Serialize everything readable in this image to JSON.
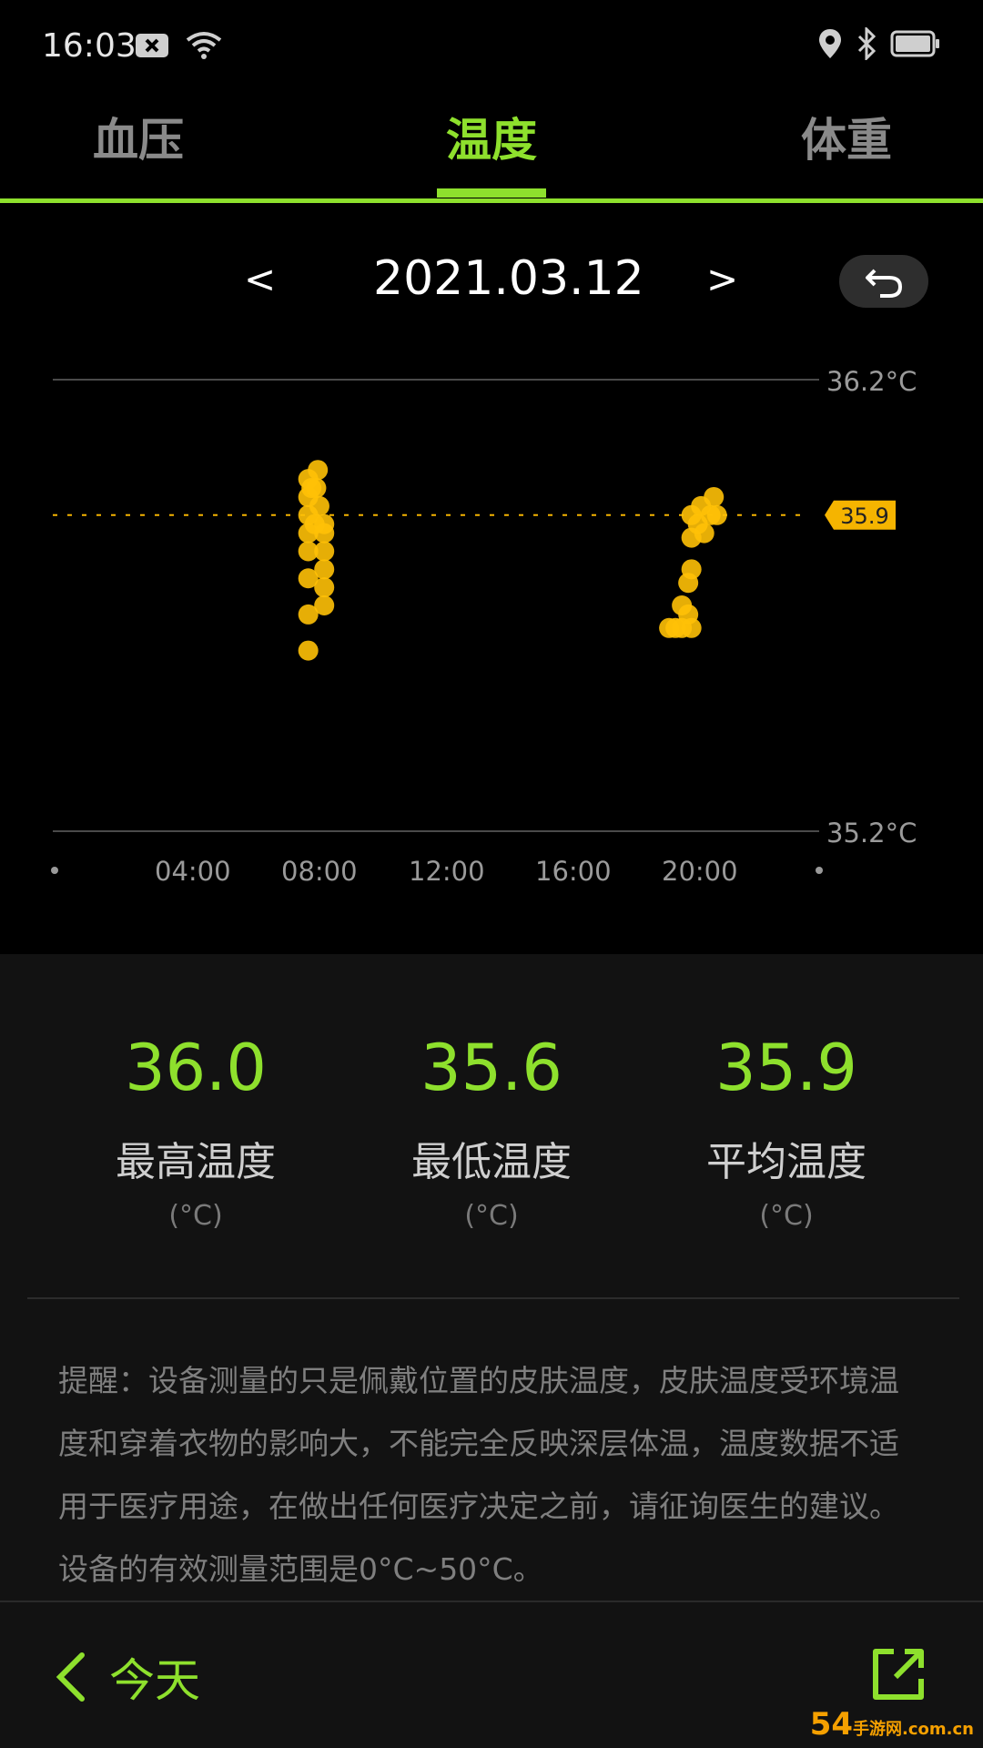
{
  "status_bar": {
    "time": "16:03"
  },
  "tabs": [
    {
      "label": "血压"
    },
    {
      "label": "温度"
    },
    {
      "label": "体重"
    }
  ],
  "date_nav": {
    "prev": "<",
    "date": "2021.03.12",
    "next": ">"
  },
  "chart_data": {
    "type": "scatter",
    "ylim": [
      35.2,
      36.2
    ],
    "y_axis_labels": [
      "36.2°C",
      "35.2°C"
    ],
    "x_ticks": [
      "04:00",
      "08:00",
      "12:00",
      "16:00",
      "20:00"
    ],
    "average_line": 35.9,
    "average_label": "35.9",
    "points": [
      {
        "x": 8.0,
        "y": 35.6
      },
      {
        "x": 8.0,
        "y": 35.68
      },
      {
        "x": 8.0,
        "y": 35.76
      },
      {
        "x": 8.0,
        "y": 35.82
      },
      {
        "x": 8.0,
        "y": 35.86
      },
      {
        "x": 8.0,
        "y": 35.9
      },
      {
        "x": 8.0,
        "y": 35.94
      },
      {
        "x": 8.0,
        "y": 35.98
      },
      {
        "x": 8.1,
        "y": 35.96
      },
      {
        "x": 8.2,
        "y": 35.88
      },
      {
        "x": 8.25,
        "y": 35.96
      },
      {
        "x": 8.3,
        "y": 36.0
      },
      {
        "x": 8.35,
        "y": 35.92
      },
      {
        "x": 8.5,
        "y": 35.78
      },
      {
        "x": 8.5,
        "y": 35.82
      },
      {
        "x": 8.5,
        "y": 35.86
      },
      {
        "x": 8.5,
        "y": 35.88
      },
      {
        "x": 8.5,
        "y": 35.74
      },
      {
        "x": 8.5,
        "y": 35.7
      },
      {
        "x": 19.3,
        "y": 35.65
      },
      {
        "x": 19.5,
        "y": 35.65
      },
      {
        "x": 19.7,
        "y": 35.65
      },
      {
        "x": 19.7,
        "y": 35.7
      },
      {
        "x": 19.9,
        "y": 35.68
      },
      {
        "x": 19.9,
        "y": 35.75
      },
      {
        "x": 20.0,
        "y": 35.65
      },
      {
        "x": 20.0,
        "y": 35.78
      },
      {
        "x": 20.0,
        "y": 35.85
      },
      {
        "x": 20.0,
        "y": 35.9
      },
      {
        "x": 20.2,
        "y": 35.88
      },
      {
        "x": 20.3,
        "y": 35.92
      },
      {
        "x": 20.4,
        "y": 35.86
      },
      {
        "x": 20.6,
        "y": 35.9
      },
      {
        "x": 20.7,
        "y": 35.94
      },
      {
        "x": 20.8,
        "y": 35.9
      }
    ]
  },
  "stats": [
    {
      "value": "36.0",
      "label": "最高温度",
      "unit": "(°C)"
    },
    {
      "value": "35.6",
      "label": "最低温度",
      "unit": "(°C)"
    },
    {
      "value": "35.9",
      "label": "平均温度",
      "unit": "(°C)"
    }
  ],
  "note": "提醒：设备测量的只是佩戴位置的皮肤温度，皮肤温度受环境温度和穿着衣物的影响大，不能完全反映深层体温，温度数据不适用于医疗用途，在做出任何医疗决定之前，请征询医生的建议。设备的有效测量范围是0°C~50°C。",
  "footer": {
    "today_label": "今天"
  },
  "watermark": {
    "brand": "54",
    "site": "手游网",
    "domain": ".com.cn"
  },
  "colors": {
    "accent": "#8ee02d",
    "point": "#ffc107",
    "average": "#f5b400"
  }
}
